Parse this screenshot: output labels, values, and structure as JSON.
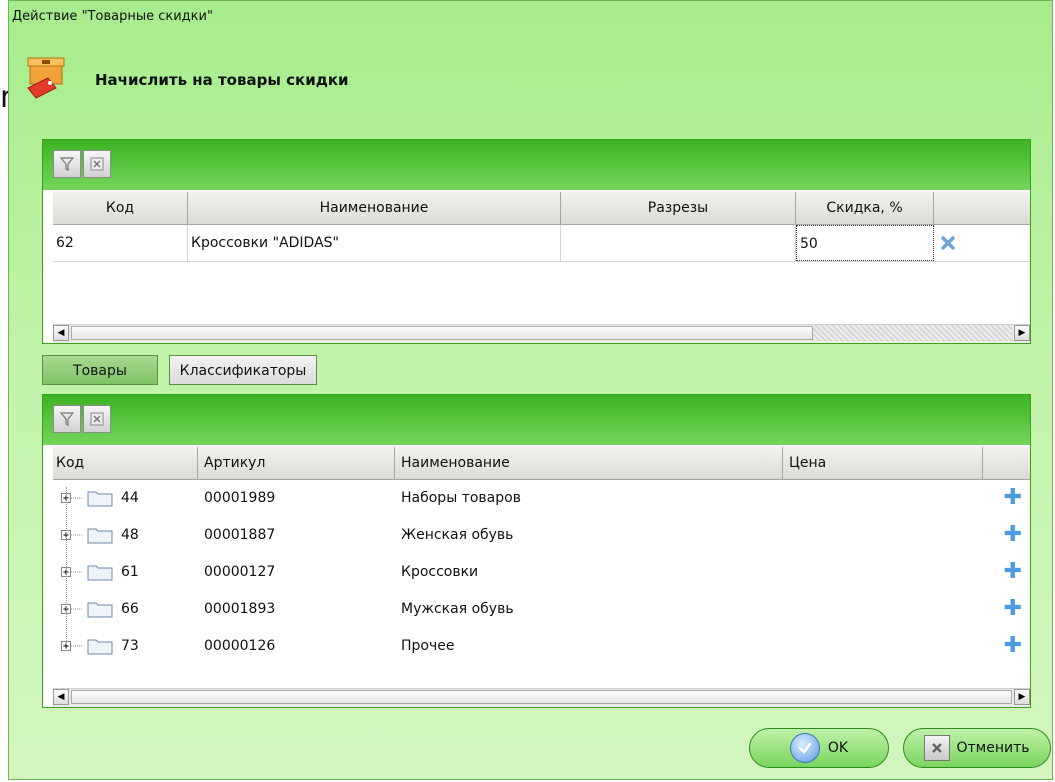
{
  "dialog": {
    "title": "Действие \"Товарные скидки\"",
    "header_text": "Начислить на товары скидки",
    "stray_glyph": "m"
  },
  "selected_panel": {
    "columns": [
      "Код",
      "Наименование",
      "Разрезы",
      "Скидка, %",
      ""
    ],
    "rows": [
      {
        "code": "62",
        "name": "Кроссовки \"ADIDAS\"",
        "sections": "",
        "discount": "50"
      }
    ]
  },
  "tabs": {
    "goods": "Товары",
    "classifiers": "Классификаторы",
    "active": "goods"
  },
  "goods_panel": {
    "columns": [
      "Код",
      "Артикул",
      "Наименование",
      "Цена",
      ""
    ],
    "rows": [
      {
        "code": "44",
        "article": "00001989",
        "name": "Наборы товаров",
        "price": ""
      },
      {
        "code": "48",
        "article": "00001887",
        "name": "Женская обувь",
        "price": ""
      },
      {
        "code": "61",
        "article": "00000127",
        "name": "Кроссовки",
        "price": ""
      },
      {
        "code": "66",
        "article": "00001893",
        "name": "Мужская обувь",
        "price": ""
      },
      {
        "code": "73",
        "article": "00000126",
        "name": "Прочее",
        "price": ""
      }
    ]
  },
  "buttons": {
    "ok": "OK",
    "cancel": "Отменить"
  },
  "icons": {
    "header": "sale-box-icon",
    "filter": "filter-icon",
    "clear_filter": "clear-filter-icon",
    "remove": "remove-x-icon",
    "add": "add-plus-icon",
    "expand": "tree-expand-icon",
    "folder": "folder-icon"
  },
  "colors": {
    "accent": "#34a41a",
    "window_bg": "#c1f3a8",
    "plus": "#4a9be0"
  }
}
